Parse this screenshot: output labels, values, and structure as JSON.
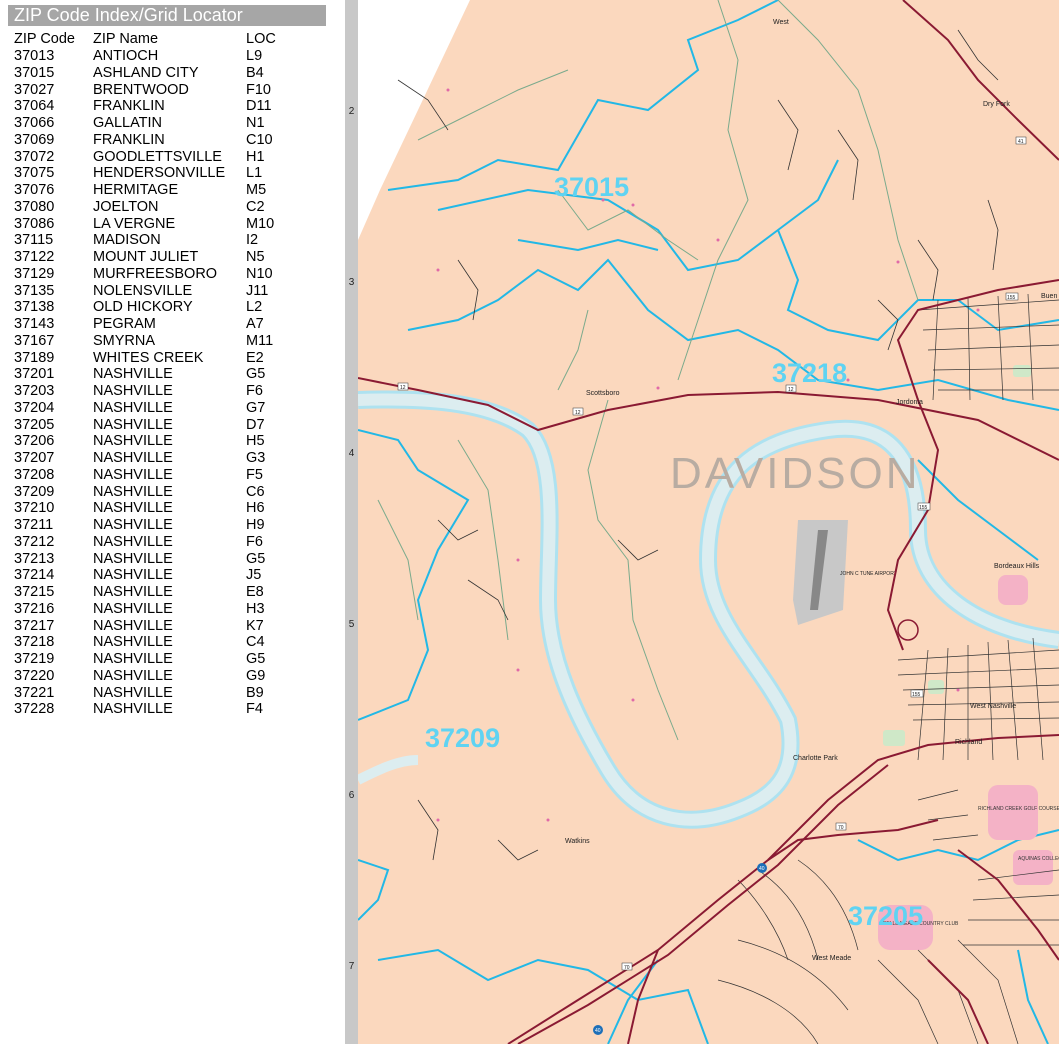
{
  "index": {
    "title": "ZIP Code Index/Grid Locator",
    "headers": {
      "code": "ZIP Code",
      "name": "ZIP Name",
      "loc": "LOC"
    },
    "rows": [
      {
        "code": "37013",
        "name": "ANTIOCH",
        "loc": "L9"
      },
      {
        "code": "37015",
        "name": "ASHLAND CITY",
        "loc": "B4"
      },
      {
        "code": "37027",
        "name": "BRENTWOOD",
        "loc": "F10"
      },
      {
        "code": "37064",
        "name": "FRANKLIN",
        "loc": "D11"
      },
      {
        "code": "37066",
        "name": "GALLATIN",
        "loc": "N1"
      },
      {
        "code": "37069",
        "name": "FRANKLIN",
        "loc": "C10"
      },
      {
        "code": "37072",
        "name": "GOODLETTSVILLE",
        "loc": "H1"
      },
      {
        "code": "37075",
        "name": "HENDERSONVILLE",
        "loc": "L1"
      },
      {
        "code": "37076",
        "name": "HERMITAGE",
        "loc": "M5"
      },
      {
        "code": "37080",
        "name": "JOELTON",
        "loc": "C2"
      },
      {
        "code": "37086",
        "name": "LA VERGNE",
        "loc": "M10"
      },
      {
        "code": "37115",
        "name": "MADISON",
        "loc": "I2"
      },
      {
        "code": "37122",
        "name": "MOUNT JULIET",
        "loc": "N5"
      },
      {
        "code": "37129",
        "name": "MURFREESBORO",
        "loc": "N10"
      },
      {
        "code": "37135",
        "name": "NOLENSVILLE",
        "loc": "J11"
      },
      {
        "code": "37138",
        "name": "OLD HICKORY",
        "loc": "L2"
      },
      {
        "code": "37143",
        "name": "PEGRAM",
        "loc": "A7"
      },
      {
        "code": "37167",
        "name": "SMYRNA",
        "loc": "M11"
      },
      {
        "code": "37189",
        "name": "WHITES CREEK",
        "loc": "E2"
      },
      {
        "code": "37201",
        "name": "NASHVILLE",
        "loc": "G5"
      },
      {
        "code": "37203",
        "name": "NASHVILLE",
        "loc": "F6"
      },
      {
        "code": "37204",
        "name": "NASHVILLE",
        "loc": "G7"
      },
      {
        "code": "37205",
        "name": "NASHVILLE",
        "loc": "D7"
      },
      {
        "code": "37206",
        "name": "NASHVILLE",
        "loc": "H5"
      },
      {
        "code": "37207",
        "name": "NASHVILLE",
        "loc": "G3"
      },
      {
        "code": "37208",
        "name": "NASHVILLE",
        "loc": "F5"
      },
      {
        "code": "37209",
        "name": "NASHVILLE",
        "loc": "C6"
      },
      {
        "code": "37210",
        "name": "NASHVILLE",
        "loc": "H6"
      },
      {
        "code": "37211",
        "name": "NASHVILLE",
        "loc": "H9"
      },
      {
        "code": "37212",
        "name": "NASHVILLE",
        "loc": "F6"
      },
      {
        "code": "37213",
        "name": "NASHVILLE",
        "loc": "G5"
      },
      {
        "code": "37214",
        "name": "NASHVILLE",
        "loc": "J5"
      },
      {
        "code": "37215",
        "name": "NASHVILLE",
        "loc": "E8"
      },
      {
        "code": "37216",
        "name": "NASHVILLE",
        "loc": "H3"
      },
      {
        "code": "37217",
        "name": "NASHVILLE",
        "loc": "K7"
      },
      {
        "code": "37218",
        "name": "NASHVILLE",
        "loc": "C4"
      },
      {
        "code": "37219",
        "name": "NASHVILLE",
        "loc": "G5"
      },
      {
        "code": "37220",
        "name": "NASHVILLE",
        "loc": "G9"
      },
      {
        "code": "37221",
        "name": "NASHVILLE",
        "loc": "B9"
      },
      {
        "code": "37228",
        "name": "NASHVILLE",
        "loc": "F4"
      }
    ]
  },
  "grid_rows": [
    "2",
    "3",
    "4",
    "5",
    "6",
    "7"
  ],
  "map": {
    "county": "DAVIDSON",
    "zip_labels": [
      "37015",
      "37218",
      "37209",
      "37205"
    ],
    "places": [
      "West",
      "Dry Fork",
      "Buen",
      "Scottsboro",
      "Jordonia",
      "Bordeaux Hills",
      "West Nashville",
      "Richland",
      "Charlotte Park",
      "Watkins",
      "West Meade"
    ],
    "pois": [
      "JOHN C TUNE AIRPORT",
      "RICHLAND CREEK GOLF COURSE",
      "BELLE MEADE COUNTRY CLUB",
      "AQUINAS COLLEGE"
    ],
    "shields": [
      "12",
      "12",
      "12",
      "41",
      "155",
      "155",
      "155",
      "70",
      "70",
      "40",
      "40"
    ],
    "colors": {
      "land": "#fbd8be",
      "zip_boundary": "#22b8e6",
      "river": "#dcedf0",
      "river_edge": "#aee2f0",
      "highway": "#8a1a33",
      "secondary_road": "#7aaa8c",
      "street": "#333333",
      "park": "#cfe8c8",
      "special": "#f4b2c6",
      "zip_label": "#5fd3f2",
      "county_label": "#b8aca2"
    }
  }
}
